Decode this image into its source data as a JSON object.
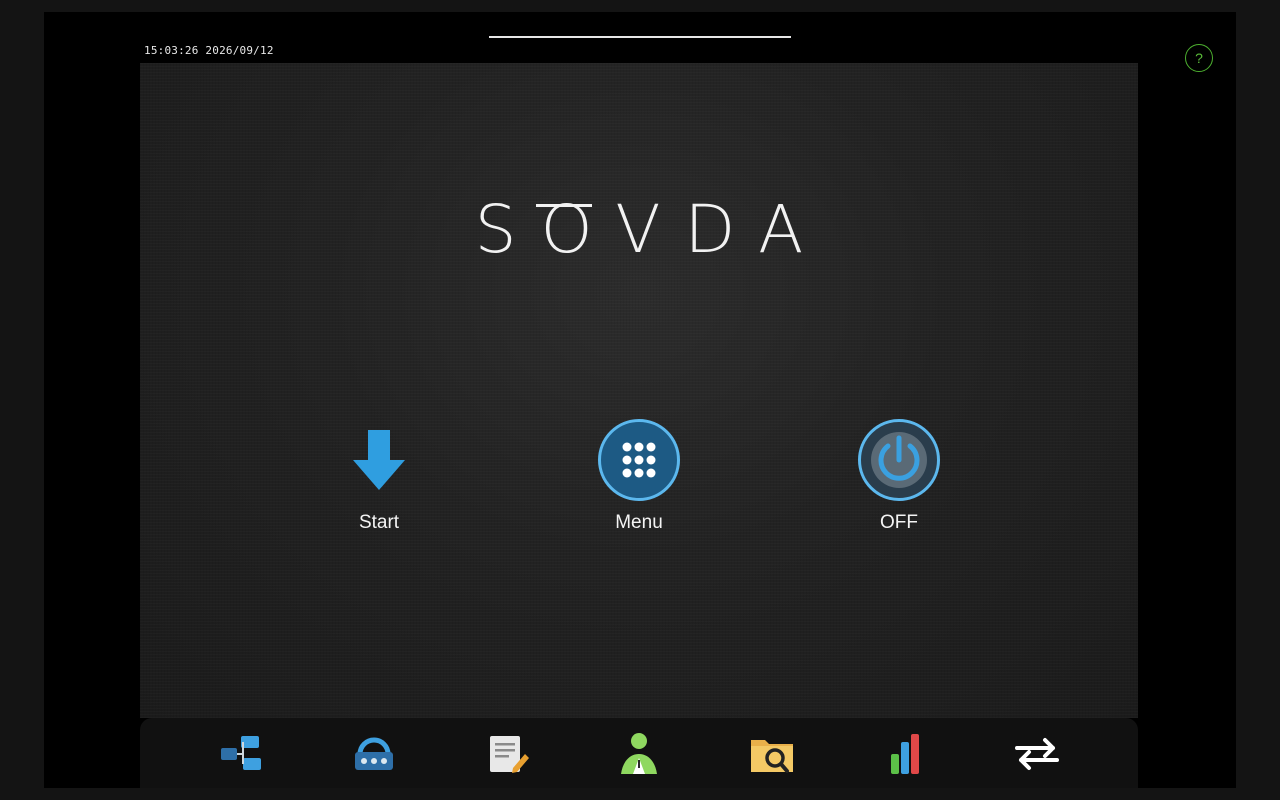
{
  "status": {
    "time": "15:03:26",
    "date": "2026/09/12",
    "help_label": "?"
  },
  "logo": {
    "text": "SOVDA"
  },
  "actions": [
    {
      "label": "Start",
      "icon": "download-arrow-icon"
    },
    {
      "label": "Menu",
      "icon": "grid-dots-icon"
    },
    {
      "label": "OFF",
      "icon": "power-icon"
    }
  ],
  "dock": [
    {
      "icon": "hierarchy-icon"
    },
    {
      "icon": "keyboard-lock-icon"
    },
    {
      "icon": "edit-document-icon"
    },
    {
      "icon": "user-icon"
    },
    {
      "icon": "folder-search-icon"
    },
    {
      "icon": "bar-chart-icon"
    },
    {
      "icon": "transfer-arrows-icon"
    }
  ],
  "colors": {
    "accent_blue": "#3aa0e0",
    "help_green": "#5bbd3a",
    "background": "#000000"
  }
}
